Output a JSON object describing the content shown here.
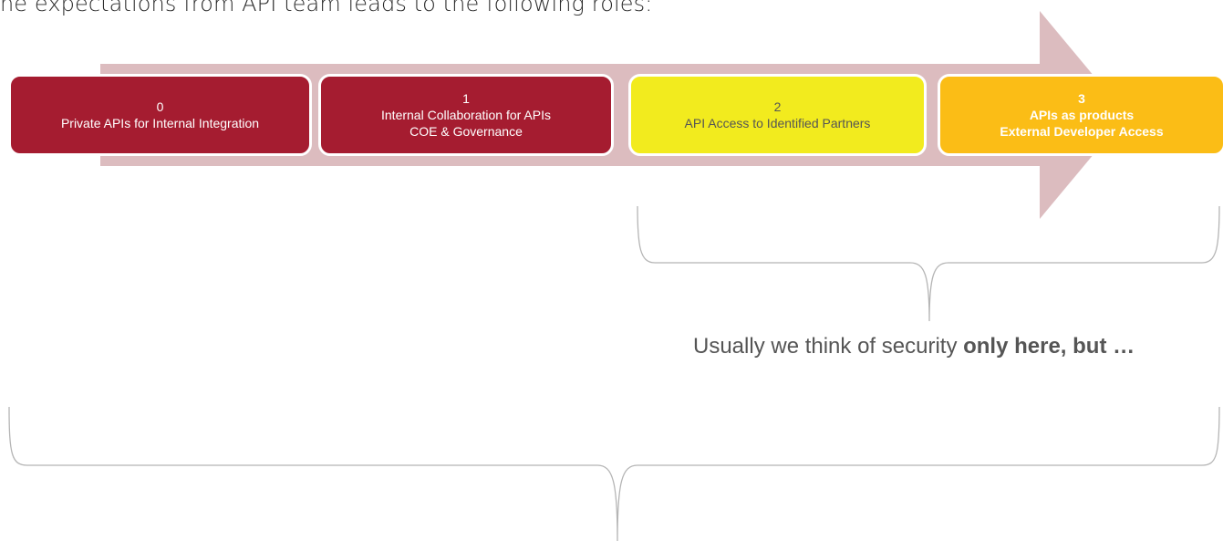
{
  "intro": "he expectations from API team leads to the following roles:",
  "colors": {
    "arrow": "#dcbcbf",
    "crimson": "#a51c30",
    "yellow": "#f2eb1e",
    "amber": "#fbbd16",
    "brace": "#b5b5b5"
  },
  "stages": [
    {
      "number": "0",
      "line1": "Private APIs for Internal Integration",
      "line2": ""
    },
    {
      "number": "1",
      "line1": "Internal Collaboration for APIs",
      "line2": "COE & Governance"
    },
    {
      "number": "2",
      "line1": "API Access to Identified Partners",
      "line2": ""
    },
    {
      "number": "3",
      "line1": "APIs as products",
      "line2": "External Developer Access"
    }
  ],
  "note": {
    "text": "Usually we think of security ",
    "emphasis": "only here, but …"
  }
}
